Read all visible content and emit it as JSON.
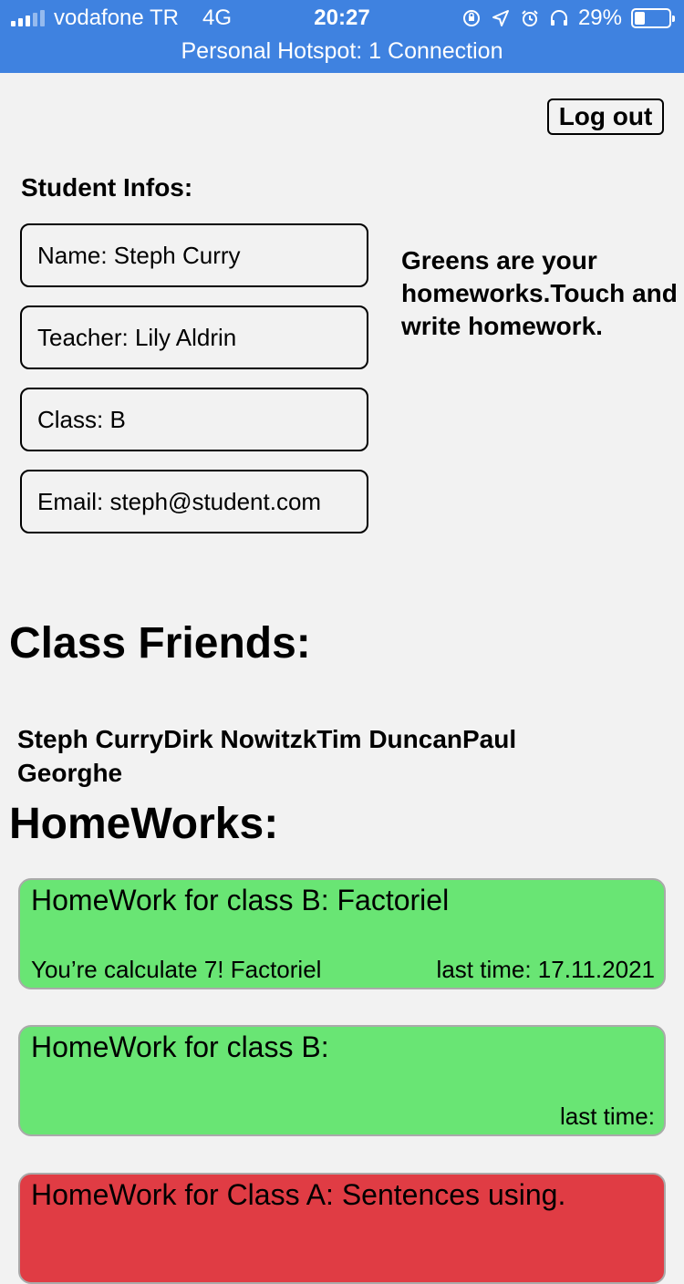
{
  "status_bar": {
    "carrier": "vodafone TR",
    "network": "4G",
    "time": "20:27",
    "battery": "29%",
    "hotspot": "Personal Hotspot: 1 Connection",
    "icons": [
      "lock-rotation-icon",
      "location-arrow-icon",
      "alarm-icon",
      "headphones-icon",
      "battery-icon"
    ]
  },
  "header": {
    "logout_label": "Log out"
  },
  "student": {
    "title": "Student Infos:",
    "name": "Name: Steph Curry",
    "teacher": "Teacher: Lily Aldrin",
    "class": "Class: B",
    "email": "Email: steph@student.com"
  },
  "hint": "Greens are your homeworks.Touch and write homework.",
  "friends": {
    "title": "Class Friends:",
    "names": "Steph CurryDirk NowitzkTim DuncanPaul Georghe"
  },
  "homeworks": {
    "title": "HomeWorks:",
    "items": [
      {
        "title": "HomeWork for class B: Factoriel",
        "description": "You’re calculate 7! Factoriel",
        "date": "last time: 17.11.2021",
        "color": "#69e574"
      },
      {
        "title": "HomeWork for class B:",
        "description": "",
        "date": "last time:",
        "color": "#69e574"
      },
      {
        "title": "HomeWork for Class A: Sentences using.",
        "description": "",
        "date": "",
        "color": "#e03c44"
      }
    ]
  }
}
